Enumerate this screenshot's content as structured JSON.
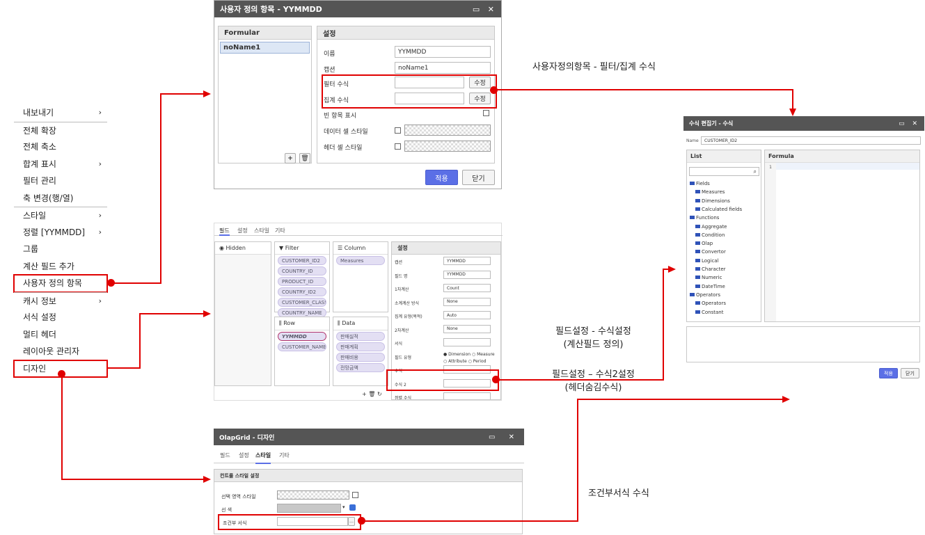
{
  "menu": {
    "items": [
      {
        "label": "내보내기",
        "arrow": "›"
      },
      {
        "label": "전체 확장"
      },
      {
        "label": "전체 축소"
      },
      {
        "label": "합계 표시",
        "arrow": "›"
      },
      {
        "label": "필터 관리"
      },
      {
        "label": "축 변경(행/열)"
      },
      {
        "label": "스타일",
        "arrow": "›"
      },
      {
        "label": "정렬 [YYMMDD]",
        "arrow": "›"
      },
      {
        "label": "그룹"
      },
      {
        "label": "계산 필드 추가"
      },
      {
        "label": "사용자 정의 항목"
      },
      {
        "label": "캐시 정보",
        "arrow": "›"
      },
      {
        "label": "서식 설정"
      },
      {
        "label": "멀티 헤더"
      },
      {
        "label": "레이아웃 관리자"
      },
      {
        "label": "디자인"
      }
    ]
  },
  "dlg1": {
    "title": "사용자 정의 항목 - YYMMDD",
    "controls": "▭ ✕",
    "list_header": "Formular",
    "list_item": "noName1",
    "add": "+",
    "del": "🗑",
    "settings_header": "설정",
    "name_label": "이름",
    "name_value": "YYMMDD",
    "caption_label": "캡션",
    "caption_value": "noName1",
    "filter_label": "필터 수식",
    "agg_label": "집계 수식",
    "edit_btn": "수정",
    "empty_label": "빈 항목 표시",
    "data_style_label": "데이터 셀 스타일",
    "header_style_label": "헤더 셀 스타일",
    "apply": "적용",
    "close": "닫기"
  },
  "ann1": "사용자정의항목  - 필터/집계 수식",
  "dlg2": {
    "tabs": [
      "필드",
      "설정",
      "스타일",
      "기타"
    ],
    "hidden": "Hidden",
    "filter": "Filter",
    "column": "Column",
    "row": "Row",
    "data": "Data",
    "settings": "설정",
    "filter_chips": [
      "CUSTOMER_ID2",
      "COUNTRY_ID",
      "PRODUCT_ID",
      "COUNTRY_ID2",
      "CUSTOMER_CLASS",
      "COUNTRY_NAME"
    ],
    "column_chips": [
      "Measures"
    ],
    "row_chips": [
      "YYMMDD",
      "CUSTOMER_NAME"
    ],
    "data_chips": [
      "판매실적",
      "판매계획",
      "판매비용",
      "전망금액"
    ],
    "props": [
      {
        "label": "캡션",
        "value": "YYMMDD"
      },
      {
        "label": "필드 명",
        "value": "YYMMDD"
      },
      {
        "label": "1차계산",
        "value": "Count"
      },
      {
        "label": "소계계산 방식",
        "value": "None"
      },
      {
        "label": "집계 유형(목적)",
        "value": "Auto"
      },
      {
        "label": "2차계산",
        "value": "None"
      },
      {
        "label": "서식",
        "value": ""
      },
      {
        "label": "필드 유형",
        "value": ""
      },
      {
        "label": "수식",
        "value": ""
      },
      {
        "label": "수식 2",
        "value": ""
      },
      {
        "label": "정렬 수식",
        "value": ""
      }
    ],
    "radio": [
      "Dimension",
      "Measure",
      "Attribute",
      "Period"
    ],
    "bottom": "+ 🗑 ↻"
  },
  "ann2": {
    "line1": "필드설정  - 수식설정",
    "line2": "(계산필드 정의)",
    "line3": "필드설정 – 수식2설정",
    "line4": "(헤더숨김수식)"
  },
  "dlg3": {
    "title": "수식 편집기 - 수식",
    "controls": "▭ ✕",
    "name_label": "Name",
    "name_value": "CUSTOMER_ID2",
    "list": "List",
    "formula": "Formula",
    "line_no": "1",
    "tree": [
      "Fields",
      "Measures",
      "Dimensions",
      "Calculated fields",
      "Functions",
      "Aggregate",
      "Condition",
      "Olap",
      "Convertor",
      "Logical",
      "Character",
      "Numeric",
      "DateTime",
      "Operators",
      "Operators",
      "Constant"
    ],
    "apply": "적용",
    "close": "닫기"
  },
  "dlg4": {
    "title": "OlapGrid - 디자인",
    "controls": "▭ ✕",
    "tabs": [
      "필드",
      "설정",
      "스타일",
      "기타"
    ],
    "section": "컨트롤 스타일 설정",
    "sel_style": "선택 영역 스타일",
    "sel_color": "선 색",
    "cond_format": "조건부 서식"
  },
  "ann3": "조건부서식 수식",
  "colors": {
    "accent": "#e00000",
    "primary": "#5b6fe6"
  }
}
